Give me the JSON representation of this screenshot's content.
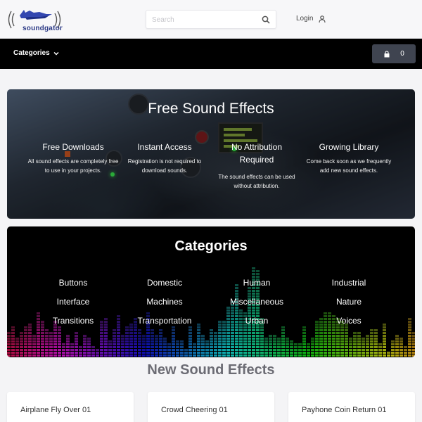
{
  "header": {
    "logo_text": "soundgator",
    "search_placeholder": "Search",
    "login_label": "Login"
  },
  "navbar": {
    "categories_label": "Categories",
    "cart_count": "0"
  },
  "hero": {
    "title": "Free Sound Effects",
    "features": [
      {
        "title": "Free Downloads",
        "text": "All sound effects are completely free to use in your projects."
      },
      {
        "title": "Instant Access",
        "text": "Registration is not required to download sounds."
      },
      {
        "title": "No Attribution Required",
        "text": "The sound effects can be used without attribution."
      },
      {
        "title": "Growing Library",
        "text": "Come back soon as we frequently add new sound effects."
      }
    ]
  },
  "categories": {
    "title": "Categories",
    "items": [
      "Buttons",
      "Domestic",
      "Human",
      "Industrial",
      "Interface",
      "Machines",
      "Miscellaneous",
      "Nature",
      "Transitions",
      "Transportation",
      "Urban",
      "Voices"
    ]
  },
  "new_sounds": {
    "title": "New Sound Effects",
    "items": [
      "Airplane Fly Over 01",
      "Crowd Cheering 01",
      "Payhone Coin Return 01"
    ]
  },
  "colors": {
    "brand": "#2c3a86",
    "navbar": "#000000",
    "cart_button": "#3f4450"
  }
}
